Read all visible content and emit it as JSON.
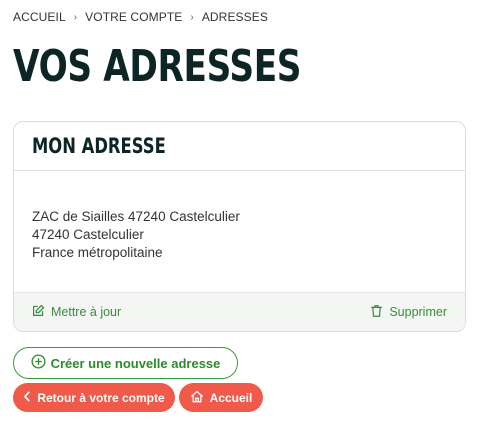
{
  "breadcrumb": {
    "items": [
      "ACCUEIL",
      "VOTRE COMPTE",
      "ADRESSES"
    ],
    "separator": "›"
  },
  "page": {
    "title": "VOS ADRESSES"
  },
  "address_card": {
    "title": "MON ADRESSE",
    "lines": [
      "ZAC de Siailles 47240 Castelculier",
      "47240 Castelculier",
      "France métropolitaine"
    ],
    "update_label": "Mettre à jour",
    "delete_label": "Supprimer"
  },
  "actions": {
    "create_label": "Créer une nouvelle adresse",
    "back_label": "Retour à votre compte",
    "home_label": "Accueil"
  },
  "icons": {
    "update": "pencil-square-icon",
    "delete": "trash-icon",
    "create": "plus-circle-icon",
    "back": "chevron-left-icon",
    "home": "home-icon"
  },
  "colors": {
    "accent_green": "#3a9a3a",
    "accent_red": "#ef5a4a",
    "title_dark": "#0d2525"
  }
}
